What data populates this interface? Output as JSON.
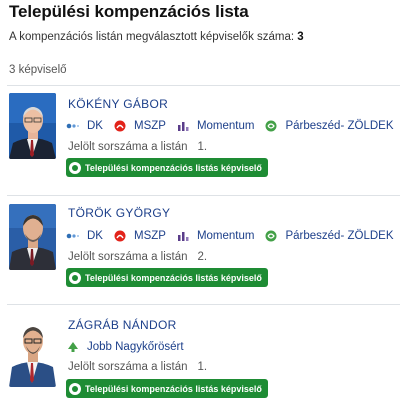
{
  "page": {
    "title": "Települési kompenzációs lista",
    "count_label": "A kompenzációs listán megválasztott képviselők száma:",
    "count_value": "3",
    "subcount": "3 képviselő"
  },
  "candidates": [
    {
      "name": "KÖKÉNY GÁBOR",
      "parties": [
        {
          "label": "DK",
          "icon": "dk-logo-icon"
        },
        {
          "label": "MSZP",
          "icon": "mszp-logo-icon"
        },
        {
          "label": "Momentum",
          "icon": "momentum-logo-icon"
        },
        {
          "label": "Párbeszéd- ZÖLDEK",
          "icon": "parbeszed-logo-icon"
        }
      ],
      "rank_label": "Jelölt sorszáma a listán",
      "rank_value": "1.",
      "badge": "Települési kompenzációs listás képviselő"
    },
    {
      "name": "TÖRÖK GYÖRGY",
      "parties": [
        {
          "label": "DK",
          "icon": "dk-logo-icon"
        },
        {
          "label": "MSZP",
          "icon": "mszp-logo-icon"
        },
        {
          "label": "Momentum",
          "icon": "momentum-logo-icon"
        },
        {
          "label": "Párbeszéd- ZÖLDEK",
          "icon": "parbeszed-logo-icon"
        }
      ],
      "rank_label": "Jelölt sorszáma a listán",
      "rank_value": "2.",
      "badge": "Települési kompenzációs listás képviselő"
    },
    {
      "name": "ZÁGRÁB NÁNDOR",
      "parties": [
        {
          "label": "Jobb Nagykőrösért",
          "icon": "jobb-nagykorosert-logo-icon"
        }
      ],
      "rank_label": "Jelölt sorszáma a listán",
      "rank_value": "1.",
      "badge": "Települési kompenzációs listás képviselő"
    }
  ],
  "colors": {
    "name": "#1c3f8a",
    "badge": "#1e8c34",
    "mszp": "#e2231a",
    "momentum": "#5a3d8a",
    "parbeszed": "#43a047",
    "dk": "#2f6fb5"
  }
}
